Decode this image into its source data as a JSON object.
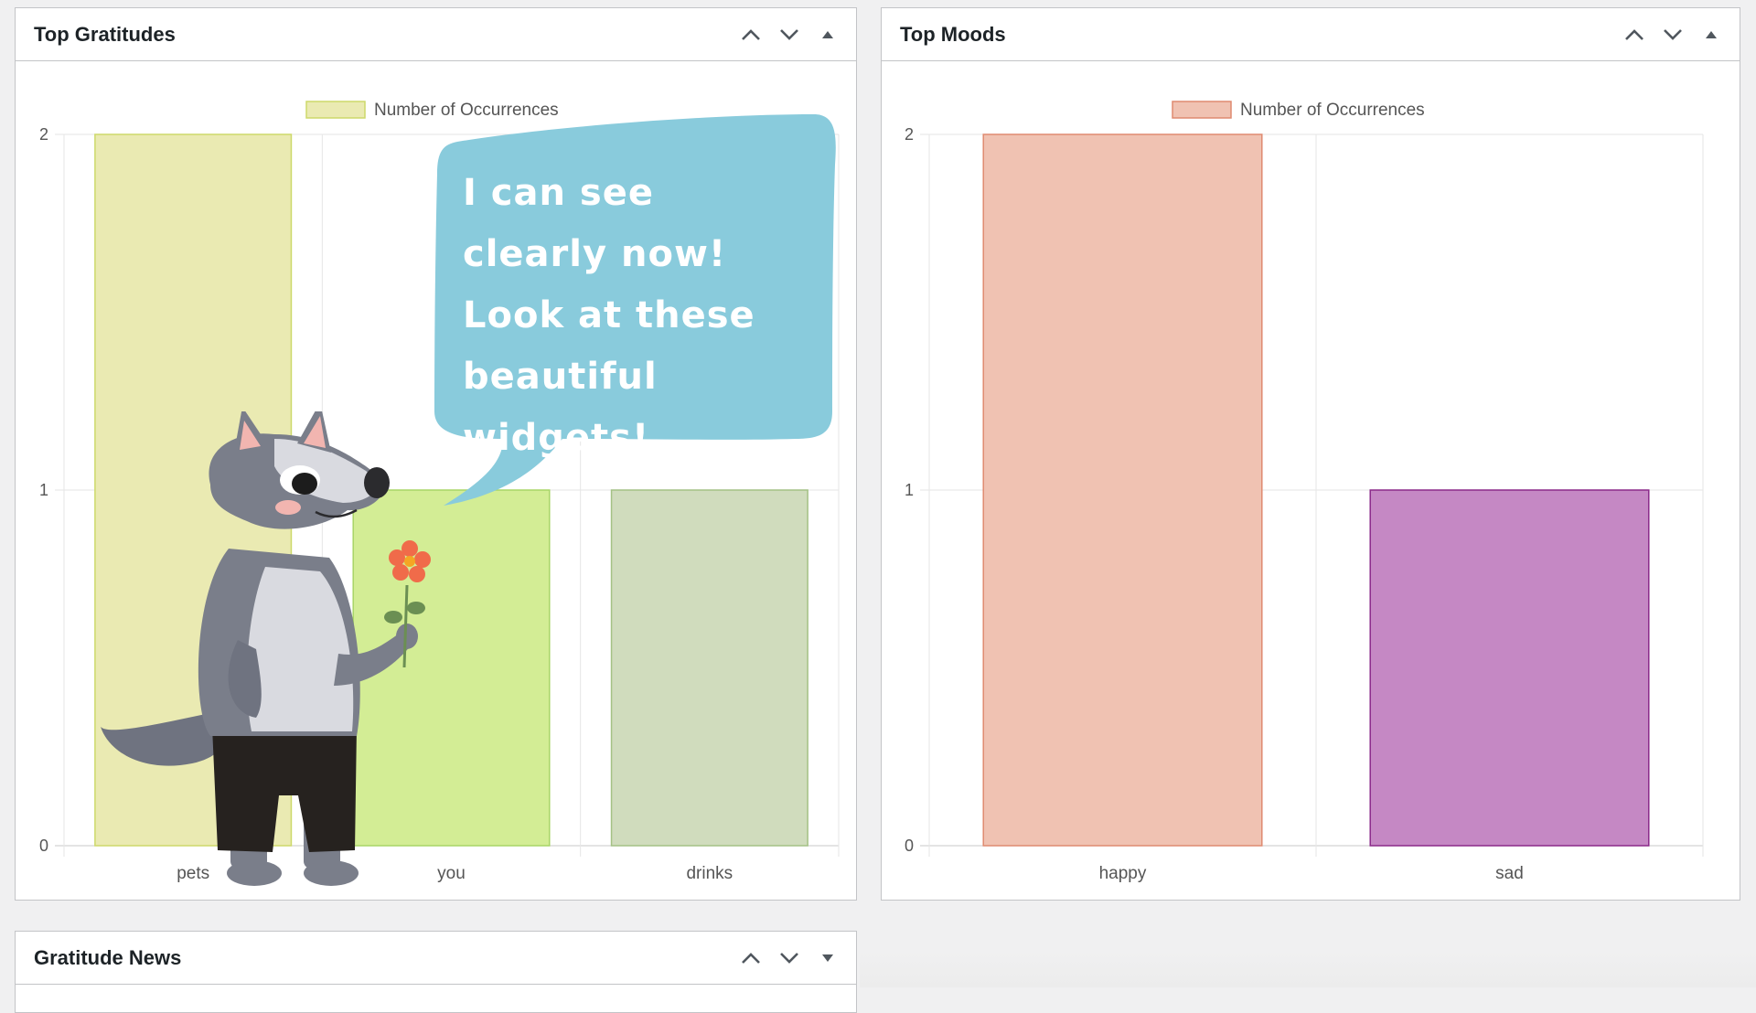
{
  "widgets": {
    "gratitudes": {
      "title": "Top Gratitudes",
      "controls": {
        "up": "Move up",
        "down": "Move down",
        "toggle": "Toggle panel"
      }
    },
    "moods": {
      "title": "Top Moods",
      "controls": {
        "up": "Move up",
        "down": "Move down",
        "toggle": "Toggle panel"
      }
    },
    "news": {
      "title": "Gratitude News",
      "controls": {
        "up": "Move up",
        "down": "Move down",
        "toggle": "Toggle panel"
      }
    }
  },
  "speech_bubble": {
    "text": "I can see clearly now! Look at these beautiful widgets!"
  },
  "colors": {
    "bubble": "#89cbdc",
    "panel_border": "#c3c4c7",
    "page_bg": "#f0f0f1"
  },
  "icons": [
    "chevron-up-icon",
    "chevron-down-icon",
    "triangle-up-icon",
    "triangle-down-icon"
  ],
  "chart_data": [
    {
      "type": "bar",
      "title": "",
      "xlabel": "",
      "ylabel": "",
      "ylim": [
        0,
        2
      ],
      "yticks": [
        0,
        1,
        2
      ],
      "grid": true,
      "legend_position": "top-center",
      "categories": [
        "pets",
        "you",
        "drinks"
      ],
      "series": [
        {
          "name": "Number of Occurrences",
          "values": [
            2,
            1,
            1
          ],
          "fill_colors": [
            "#eaeab2",
            "#d3ed95",
            "#d0dcbd"
          ],
          "stroke_colors": [
            "#cdd96a",
            "#a8d566",
            "#a4c185"
          ],
          "legend_fill": "#eaeab2",
          "legend_stroke": "#cdd96a"
        }
      ]
    },
    {
      "type": "bar",
      "title": "",
      "xlabel": "",
      "ylabel": "",
      "ylim": [
        0,
        2
      ],
      "yticks": [
        0,
        1,
        2
      ],
      "grid": true,
      "legend_position": "top-center",
      "categories": [
        "happy",
        "sad"
      ],
      "series": [
        {
          "name": "Number of Occurrences",
          "values": [
            2,
            1
          ],
          "fill_colors": [
            "#f0c2b2",
            "#c588c4"
          ],
          "stroke_colors": [
            "#df8a70",
            "#8b2a8a"
          ],
          "legend_fill": "#f0c2b2",
          "legend_stroke": "#df8a70"
        }
      ]
    }
  ]
}
